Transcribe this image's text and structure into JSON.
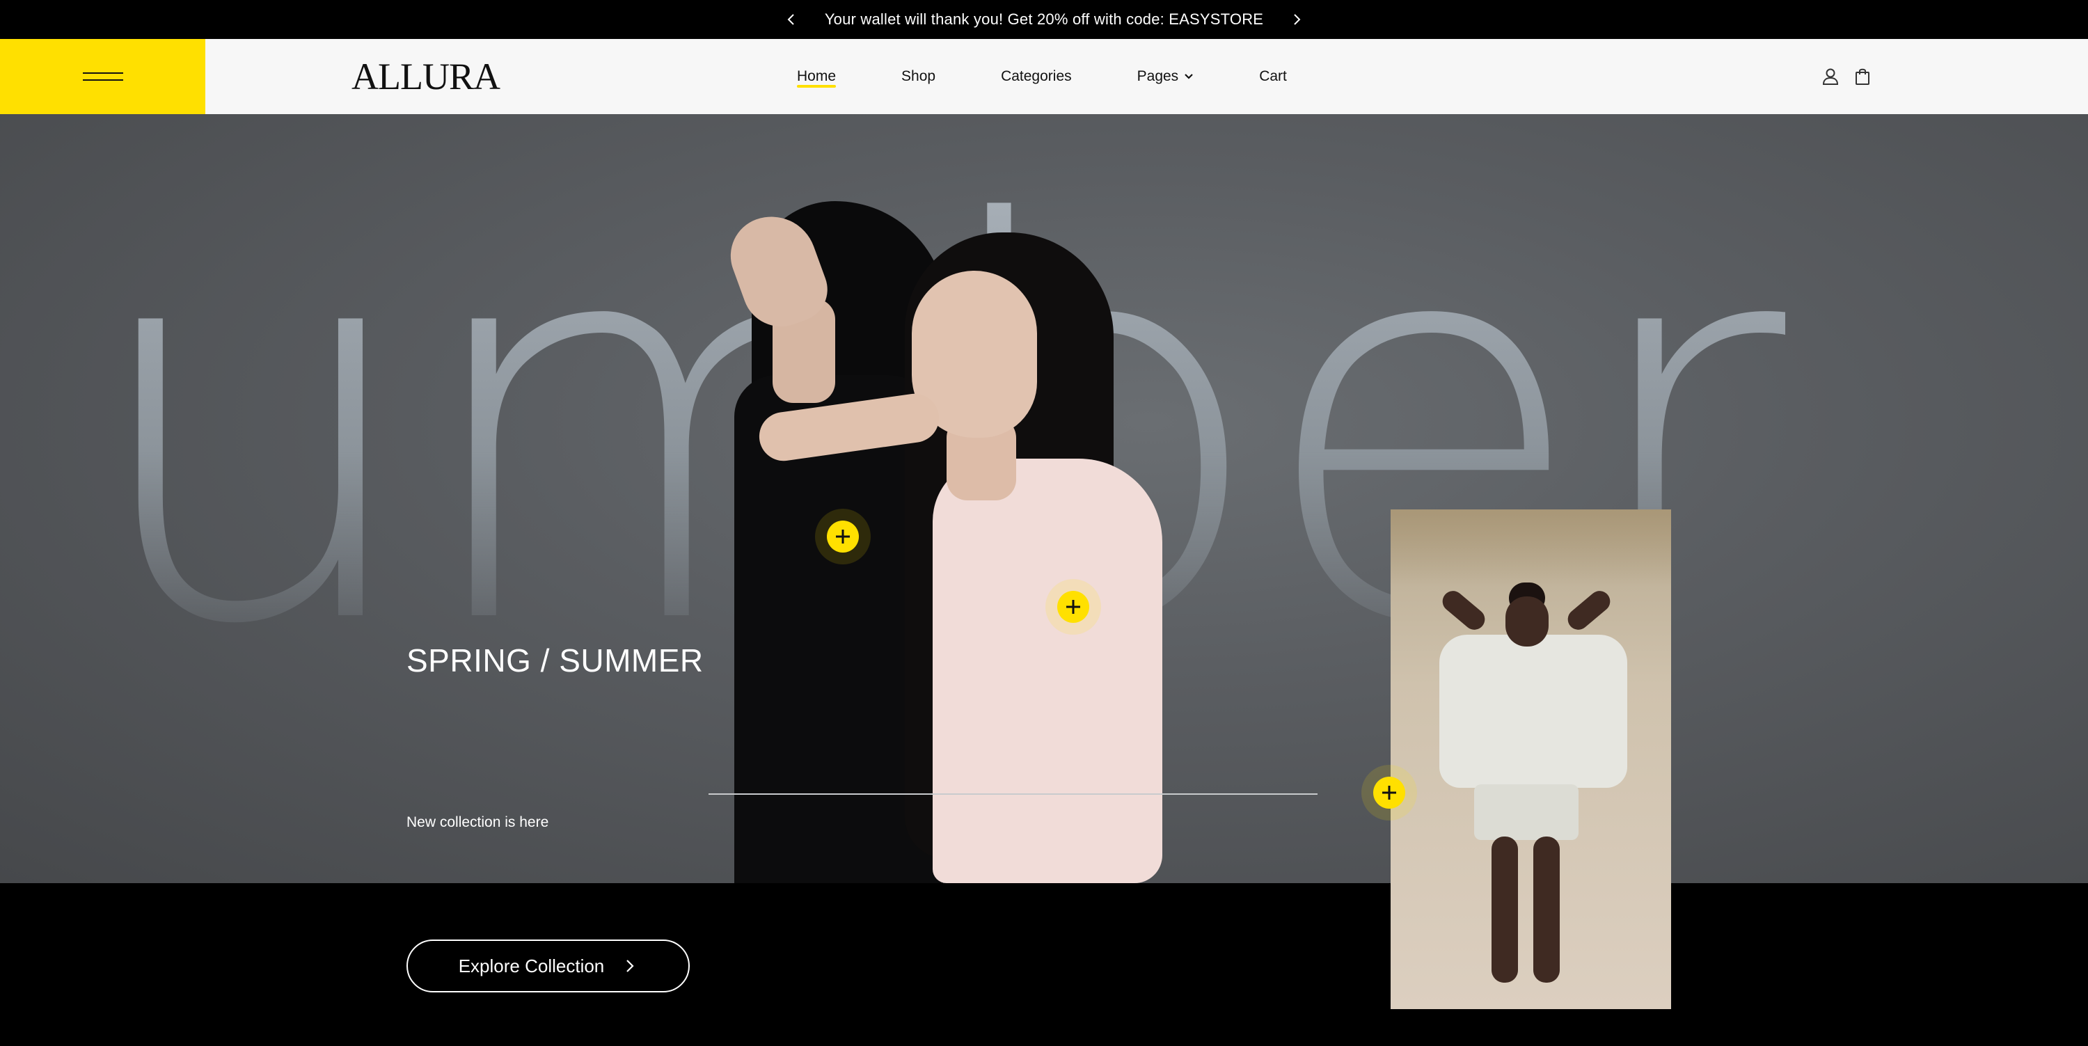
{
  "announcement": {
    "message": "Your wallet will thank you! Get 20% off with code: EASYSTORE",
    "prev_icon": "chevron-left-icon",
    "next_icon": "chevron-right-icon"
  },
  "header": {
    "logo": "ALLURA",
    "menu_icon": "hamburger-icon",
    "nav": [
      {
        "label": "Home",
        "active": true
      },
      {
        "label": "Shop"
      },
      {
        "label": "Categories"
      },
      {
        "label": "Pages",
        "has_dropdown": true
      },
      {
        "label": "Cart"
      }
    ],
    "icons": [
      "user-icon",
      "shopping-bag-icon"
    ]
  },
  "hero": {
    "background_word": "umber",
    "title": "SPRING / SUMMER",
    "subtitle": "New collection is here",
    "cta_label": "Explore Collection",
    "hotspot_icon": "plus-icon"
  },
  "colors": {
    "accent": "#ffe000",
    "header_bg": "#f7f7f7",
    "announcement_bg": "#000000",
    "hero_bg": "#55585c"
  }
}
